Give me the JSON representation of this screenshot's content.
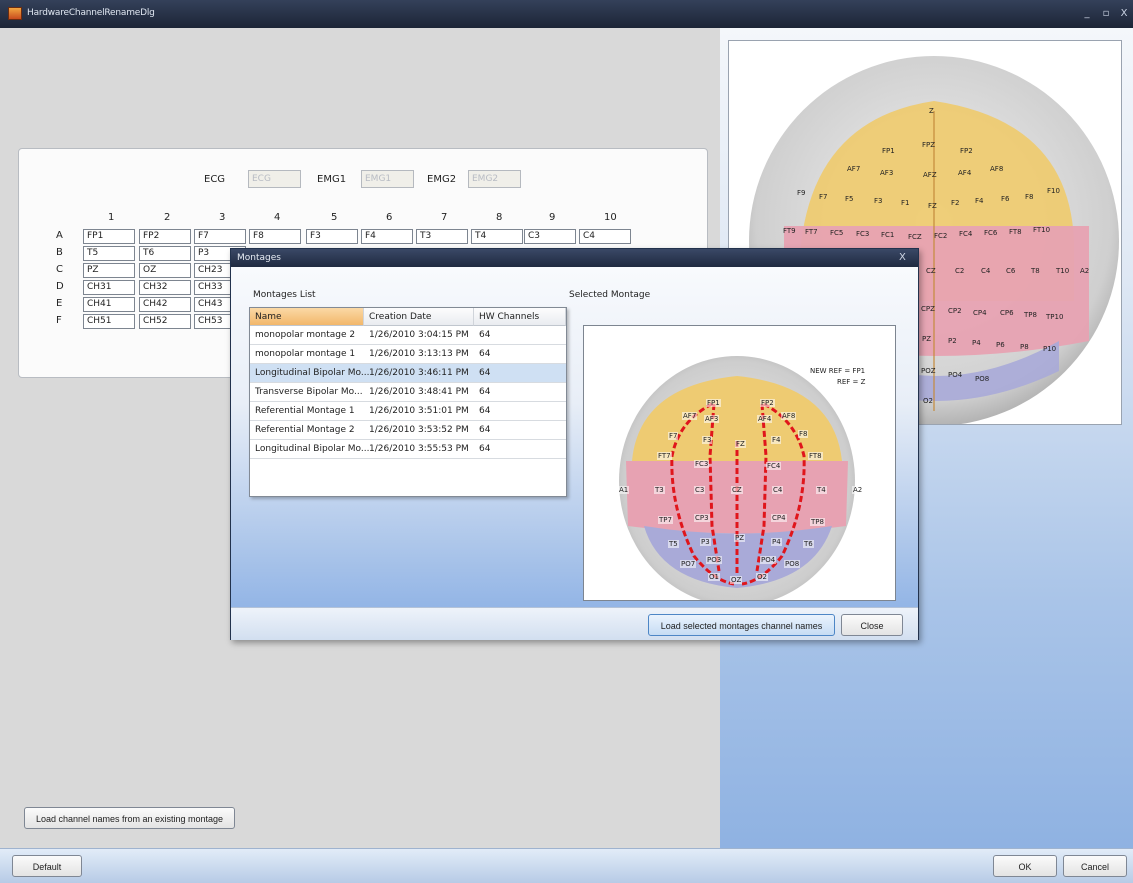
{
  "window": {
    "title": "HardwareChannelRenameDlg",
    "controls": {
      "minimize": "_",
      "restore": "▫",
      "close": "X"
    }
  },
  "grid": {
    "ecg_label": "ECG",
    "ecg_value": "ECG",
    "emg1_label": "EMG1",
    "emg1_value": "EMG1",
    "emg2_label": "EMG2",
    "emg2_value": "EMG2",
    "columns": [
      "1",
      "2",
      "3",
      "4",
      "5",
      "6",
      "7",
      "8",
      "9",
      "10"
    ],
    "rows": [
      {
        "label": "A",
        "cells": [
          "FP1",
          "FP2",
          "F7",
          "F8",
          "F3",
          "F4",
          "T3",
          "T4",
          "C3",
          "C4"
        ]
      },
      {
        "label": "B",
        "cells": [
          "T5",
          "T6",
          "P3"
        ]
      },
      {
        "label": "C",
        "cells": [
          "PZ",
          "OZ",
          "CH23"
        ]
      },
      {
        "label": "D",
        "cells": [
          "CH31",
          "CH32",
          "CH33"
        ]
      },
      {
        "label": "E",
        "cells": [
          "CH41",
          "CH42",
          "CH43"
        ]
      },
      {
        "label": "F",
        "cells": [
          "CH51",
          "CH52",
          "CH53"
        ]
      }
    ]
  },
  "buttons": {
    "load_existing": "Load channel names from an existing montage",
    "default": "Default",
    "ok": "OK",
    "cancel": "Cancel"
  },
  "right_brain": {
    "labels": [
      "Z",
      "FPZ",
      "FP1",
      "FP2",
      "AF7",
      "AF3",
      "AFZ",
      "AF4",
      "AF8",
      "F9",
      "F7",
      "F5",
      "F3",
      "F1",
      "FZ",
      "F2",
      "F4",
      "F6",
      "F8",
      "F10",
      "FT9",
      "FT7",
      "FC5",
      "FC3",
      "FC1",
      "FCZ",
      "FC2",
      "FC4",
      "FC6",
      "FT8",
      "FT10",
      "CZ",
      "C2",
      "C4",
      "C6",
      "T8",
      "T10",
      "A2",
      "CPZ",
      "CP2",
      "CP4",
      "CP6",
      "TP8",
      "TP10",
      "PZ",
      "P2",
      "P4",
      "P6",
      "P8",
      "P10",
      "POZ",
      "PO4",
      "PO8",
      "O2"
    ]
  },
  "dialog": {
    "title": "Montages",
    "close": "X",
    "list_label": "Montages List",
    "selected_label": "Selected Montage",
    "headers": [
      "Name",
      "Creation Date",
      "HW Channels"
    ],
    "rows": [
      {
        "name": "monopolar montage 2",
        "date": "1/26/2010 3:04:15 PM",
        "channels": "64",
        "selected": false
      },
      {
        "name": "monopolar montage 1",
        "date": "1/26/2010 3:13:13 PM",
        "channels": "64",
        "selected": false
      },
      {
        "name": "Longitudinal Bipolar Mo...",
        "date": "1/26/2010 3:46:11 PM",
        "channels": "64",
        "selected": true
      },
      {
        "name": "Transverse Bipolar Mo...",
        "date": "1/26/2010 3:48:41 PM",
        "channels": "64",
        "selected": false
      },
      {
        "name": "Referential Montage 1",
        "date": "1/26/2010 3:51:01 PM",
        "channels": "64",
        "selected": false
      },
      {
        "name": "Referential Montage 2",
        "date": "1/26/2010 3:53:52 PM",
        "channels": "64",
        "selected": false
      },
      {
        "name": "Longitudinal Bipolar Mo...",
        "date": "1/26/2010 3:55:53 PM",
        "channels": "64",
        "selected": false
      }
    ],
    "ref_new": "NEW REF = FP1",
    "ref": "REF = Z",
    "load_button": "Load selected montages channel names",
    "close_button": "Close",
    "montage_labels": [
      "FP1",
      "FP2",
      "AF7",
      "AF3",
      "AF4",
      "AF8",
      "F7",
      "F3",
      "FZ",
      "F4",
      "F8",
      "FT7",
      "FC3",
      "FC4",
      "FT8",
      "A1",
      "T3",
      "C3",
      "CZ",
      "C4",
      "T4",
      "A2",
      "TP7",
      "CP3",
      "CP4",
      "TP8",
      "T5",
      "P3",
      "PZ",
      "P4",
      "T6",
      "PO7",
      "PO3",
      "PO4",
      "PO8",
      "O1",
      "OZ",
      "O2"
    ]
  },
  "colors": {
    "frontal": "#f0d27e",
    "central": "#e9a8b6",
    "occipital": "#a8a9d6",
    "montage_line": "#e0151b",
    "selected_row": "#cfe0f3"
  }
}
